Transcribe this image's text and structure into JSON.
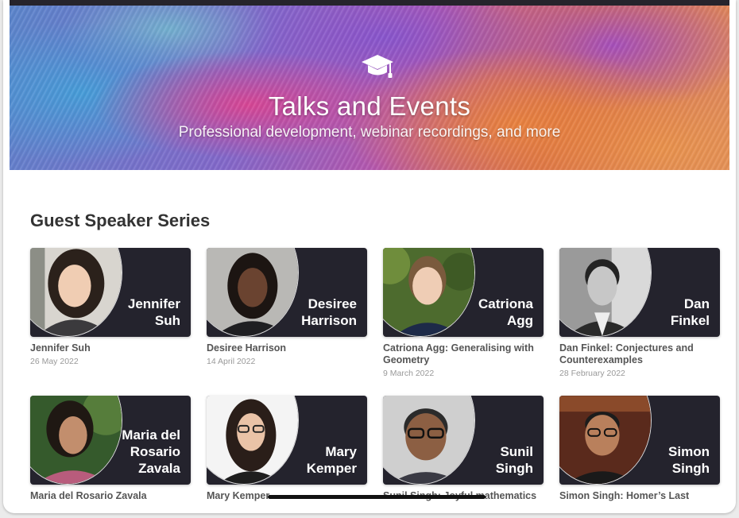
{
  "hero": {
    "title": "Talks and Events",
    "subtitle": "Professional development, webinar recordings, and more",
    "icon": "graduation-cap-icon"
  },
  "section": {
    "title": "Guest Speaker Series"
  },
  "cards": [
    {
      "name_line1": "Jennifer",
      "name_line2": "Suh",
      "name_line3": "",
      "title": "Jennifer Suh",
      "date": "26 May 2022"
    },
    {
      "name_line1": "Desiree",
      "name_line2": "Harrison",
      "name_line3": "",
      "title": "Desiree Harrison",
      "date": "14 April 2022"
    },
    {
      "name_line1": "Catriona",
      "name_line2": "Agg",
      "name_line3": "",
      "title": "Catriona Agg: Generalising with Geometry",
      "date": "9 March 2022"
    },
    {
      "name_line1": "Dan",
      "name_line2": "Finkel",
      "name_line3": "",
      "title": "Dan Finkel: Conjectures and Counterexamples",
      "date": "28 February 2022"
    },
    {
      "name_line1": "Maria del",
      "name_line2": "Rosario",
      "name_line3": "Zavala",
      "title": "Maria del Rosario Zavala",
      "date": ""
    },
    {
      "name_line1": "Mary",
      "name_line2": "Kemper",
      "name_line3": "",
      "title": "Mary Kemper",
      "date": ""
    },
    {
      "name_line1": "Sunil",
      "name_line2": "Singh",
      "name_line3": "",
      "title": "Sunil Singh: Joyful mathematics",
      "date": ""
    },
    {
      "name_line1": "Simon",
      "name_line2": "Singh",
      "name_line3": "",
      "title": "Simon Singh: Homer’s Last",
      "date": ""
    }
  ],
  "colors": {
    "card_background": "#24232d",
    "heading_text": "#333333",
    "card_title_text": "#555555",
    "date_text": "#999999"
  }
}
